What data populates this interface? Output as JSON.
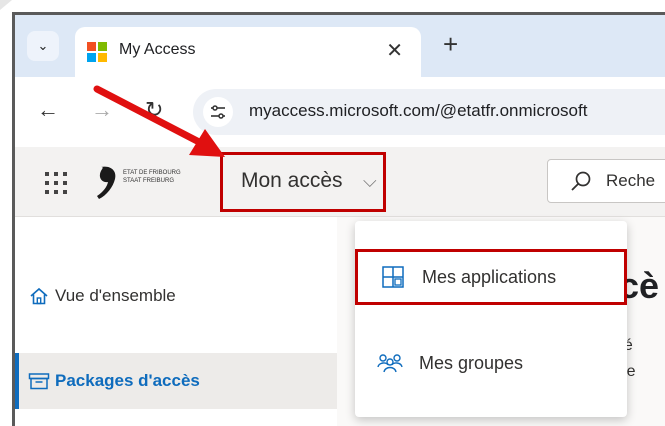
{
  "browser": {
    "tab_title": "My Access",
    "tab_close": "✕",
    "new_tab": "+",
    "tab_menu": "⌄",
    "back": "←",
    "forward": "→",
    "reload": "↻",
    "site_info_icon": "tune-icon",
    "url": "myaccess.microsoft.com/@etatfr.onmicrosoft"
  },
  "app_header": {
    "logo_text_line1": "ETAT DE FRIBOURG",
    "logo_text_line2": "STAAT FREIBURG",
    "app_switcher_label": "Mon accès",
    "app_switcher_chevron": "⌵",
    "search_placeholder": "Reche"
  },
  "left_nav": {
    "items": [
      {
        "label": "Vue d'ensemble",
        "icon": "home-icon",
        "active": false
      },
      {
        "label": "Packages d'accès",
        "icon": "package-icon",
        "active": true
      }
    ]
  },
  "main": {
    "title_partial": "ccè",
    "line1_partial": "les é",
    "line2_partial": "ou re"
  },
  "dropdown": {
    "items": [
      {
        "label": "Mes applications",
        "icon": "apps-grid-icon",
        "highlighted": true
      },
      {
        "label": "Mes groupes",
        "icon": "groups-icon",
        "highlighted": false
      }
    ]
  },
  "colors": {
    "annotation_red": "#c00000",
    "accent_blue": "#0f6cbd",
    "tabstrip": "#dde8f6",
    "header_bg": "#f3f2f1"
  }
}
